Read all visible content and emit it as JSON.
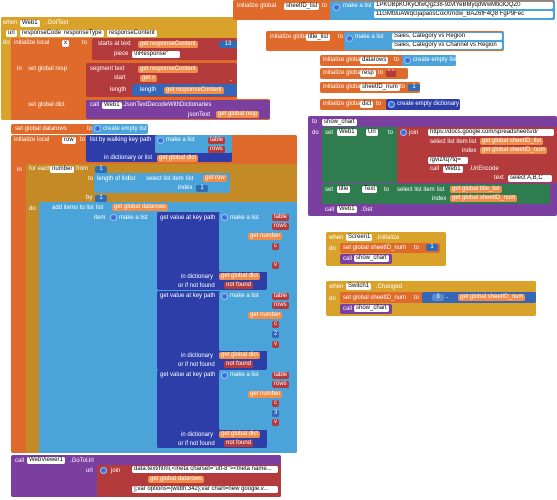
{
  "colors": {
    "event": "#d9a32b",
    "procedure": "#7b3fa0",
    "variable": "#e06a2b",
    "text": "#b33b3b",
    "list": "#4ba4d9",
    "dict": "#2d3ea8",
    "control": "#c48a26",
    "component": "#2f7d4f",
    "math": "#3467b8"
  },
  "web1_gottext": {
    "when": "when",
    "component": "Web1",
    "event": ".GotText",
    "params": [
      "url",
      "responseCode",
      "responseType",
      "responseContent"
    ],
    "do": "do",
    "init_local": "initialize local",
    "local_x": "x",
    "to": "to",
    "starts_at_text": "starts at text",
    "get_responsecontent": "get  responseContent",
    "piece": "piece",
    "piece_value": "\\nResponse\"",
    "plus13": "13",
    "in": "in",
    "set_global_resp": "set  global resp",
    "segment_text": "segment text",
    "start": "start",
    "length": "length",
    "get_x": "get  x",
    "minus": "-",
    "one": "1",
    "set_global_dict": "set  global dict",
    "call_web1": "call",
    "web1": "Web1",
    "json_decode": ".JsonTextDecodeWithDictionaries",
    "json_text": "jsonText",
    "get_global_resp": "get  global resp"
  },
  "globals": {
    "initialize_global": "initialize global",
    "to": "to",
    "make_a_list": "make a list",
    "sheet_id_list": "sheetID_list",
    "sheet_ids": [
      "1PKUBpKUKyOtwQgz38-9zvtYeBMyqdWwMtk3OQZ0",
      "11GMt9uAWqGjapaosCoxXrndw_BAZ6fF4Q8 FgP9Fec"
    ],
    "title_list": "title_list",
    "titles": [
      "Sales, Category vs Region",
      "Sales, Category vs Channel vs Region"
    ],
    "datarows": "datarows",
    "create_empty_list": "create empty list",
    "resp": "resp",
    "empty_text": "\" \"",
    "sheet_id_num": "sheetID_num",
    "one": "1",
    "dict": "dict",
    "create_empty_dict": "create empty dictionary"
  },
  "set_datarows": {
    "set": "set  global datarows",
    "to": "to",
    "create_empty_list": "create empty list",
    "init_local_row": "initialize local",
    "row": "row",
    "list_by_walking": "list by walking key path",
    "make_a_list": "make a list",
    "table": "table",
    "rows": "rows",
    "in_dict_or_list": "in dictionary or list",
    "get_global_dict": "get  global dict"
  },
  "for_each": {
    "in": "in",
    "for_each": "for each",
    "number": "number",
    "from": "from",
    "one": "1",
    "to": "to",
    "length_of_list": "length of list",
    "list": "list",
    "select_list_item": "select list item",
    "get_row": "get  row",
    "index": "index",
    "by": "by",
    "do": "do",
    "add_items": "add items to list",
    "get_global_datarows": "get  global datarows",
    "item": "item",
    "get_value_at_key_path": "get value at key path",
    "keys": [
      {
        "a": "table",
        "b": "rows",
        "c": "c",
        "v": "v",
        "idx": ""
      },
      {
        "a": "table",
        "b": "rows",
        "c": "c",
        "v": "v",
        "idx": "2"
      },
      {
        "a": "table",
        "b": "rows",
        "c": "c",
        "v": "v",
        "idx": "3"
      }
    ],
    "get_number": "get  number",
    "in_dictionary": "in dictionary",
    "get_global_dict": "get  global dict",
    "or_if_not_found": "or if not found",
    "not_found": "not found"
  },
  "show_chart": {
    "to": "to",
    "name": "show_chart",
    "do": "do",
    "set": "set",
    "web1": "Web1",
    "url": "Url",
    "to_label": "to",
    "join": "join",
    "base_url": "https://docs.google.com/spreadsheets/d/",
    "select_list_item": "select list item",
    "list": "list",
    "get_sheet_list": "get  global sheetID_list",
    "index": "index",
    "get_sheet_num": "get  global sheetID_num",
    "gviz": "/gviz/tq?tq=",
    "call": "call",
    "uriencode": ".UriEncode",
    "text": "text",
    "select_abc": "select A,B,C",
    "set_title": "set",
    "title": "title",
    "text_prop": "Text",
    "get_title_list": "get  global title_list",
    "call_get": ".Get"
  },
  "screen_init": {
    "when": "when",
    "component": "Screen1",
    "event": ".Initialize",
    "do": "do",
    "set": "set  global sheetID_num",
    "to": "to",
    "one": "1",
    "call": "call",
    "proc": "show_chart"
  },
  "switch_changed": {
    "when": "when",
    "component": "Switch1",
    "event": ".Changed",
    "do": "do",
    "set": "set  global sheetID_num",
    "to": "to",
    "three": "3",
    "minus": "-",
    "get_sheet_num": "get  global sheetID_num",
    "call": "call",
    "proc": "show_chart"
  },
  "webviewer_call": {
    "call": "call",
    "component": "WebViewer1",
    "method": ".GoToUrl",
    "url": "url",
    "join": "join",
    "html_head": "data:text/html,<meta charset=\"utf-8\"><meta name...",
    "get_datarows": "get  global datarows",
    "options": "];var options={width:342};var chart=new google.v..."
  }
}
